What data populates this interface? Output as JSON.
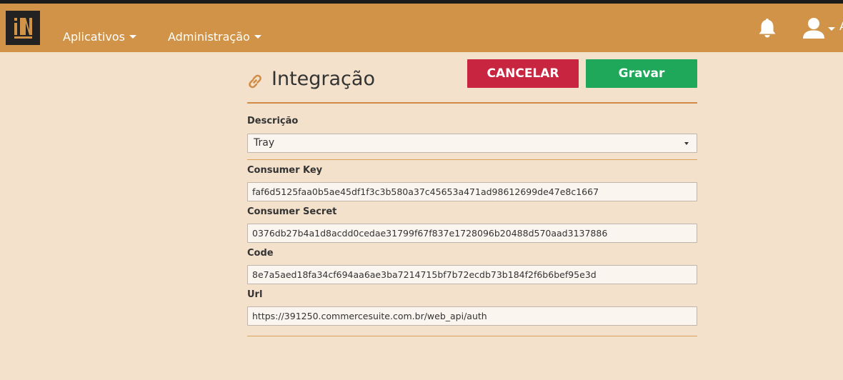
{
  "navbar": {
    "logo_text": "IN",
    "menu": [
      {
        "label": "Aplicativos"
      },
      {
        "label": "Administração"
      }
    ],
    "user_initial": "A"
  },
  "page": {
    "title": "Integração",
    "cancel_label": "CANCELAR",
    "save_label": "Gravar"
  },
  "form": {
    "descricao": {
      "label": "Descrição",
      "value": "Tray"
    },
    "consumer_key": {
      "label": "Consumer Key",
      "value": "faf6d5125faa0b5ae45df1f3c3b580a37c45653a471ad98612699de47e8c1667"
    },
    "consumer_secret": {
      "label": "Consumer Secret",
      "value": "0376db27b4a1d8acdd0cedae31799f67f837e1728096b20488d570aad3137886"
    },
    "code": {
      "label": "Code",
      "value": "8e7a5aed18fa34cf694aa6ae3ba7214715bf7b72ecdb73b184f2f6b6bef95e3d"
    },
    "url": {
      "label": "Url",
      "value": "https://391250.commercesuite.com.br/web_api/auth"
    }
  },
  "colors": {
    "navbar": "#d09348",
    "background": "#f3e1cc",
    "cancel": "#c72540",
    "save": "#1fa75a",
    "accent": "#cf8d47"
  },
  "icons": [
    "logo-icon",
    "caret-down-icon",
    "bell-icon",
    "user-icon",
    "link-icon"
  ]
}
